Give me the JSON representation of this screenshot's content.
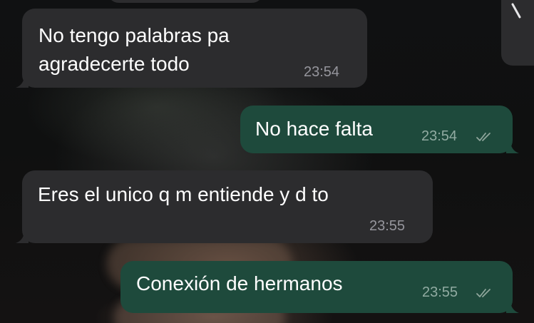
{
  "messages": [
    {
      "direction": "incoming",
      "text": "No tengo palabras pa\nagradecerte todo",
      "time": "23:54"
    },
    {
      "direction": "outgoing",
      "text": "No hace falta",
      "time": "23:54",
      "status": "read"
    },
    {
      "direction": "incoming",
      "text": "Eres el unico q m entiende y d to",
      "time": "23:55"
    },
    {
      "direction": "outgoing",
      "text": "Conexión de hermanos",
      "time": "23:55",
      "status": "read"
    }
  ],
  "colors": {
    "incoming_bubble": "#2c2c2e",
    "outgoing_bubble": "#1e4a3c",
    "text": "#ffffff",
    "timestamp": "#a0a0a8"
  },
  "icons": {
    "read_receipt": "double-check-icon"
  }
}
